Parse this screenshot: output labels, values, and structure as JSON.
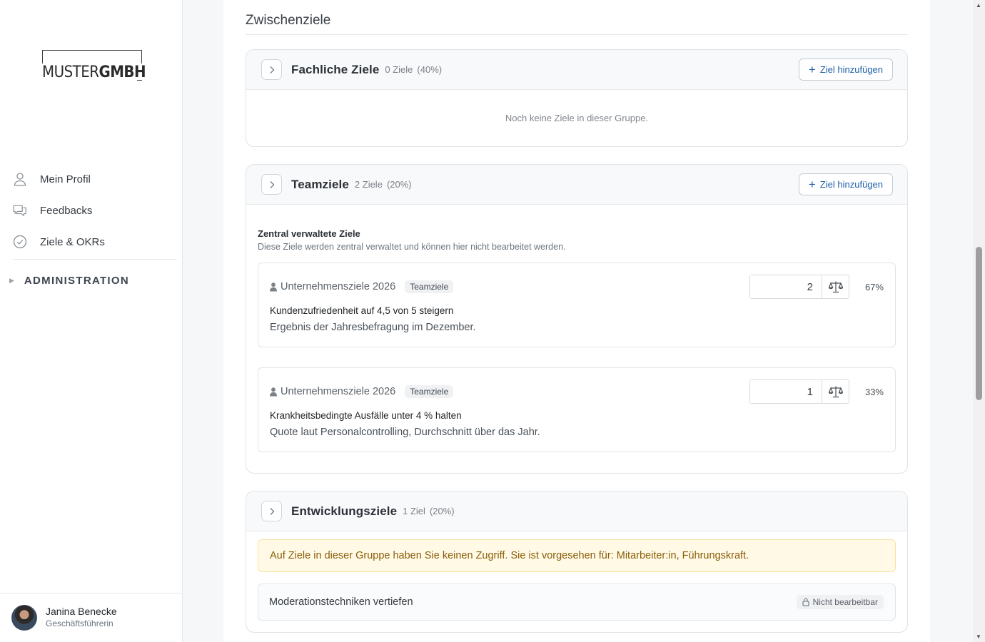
{
  "brand": {
    "logo_light": "MUSTER",
    "logo_bold": "GMBH"
  },
  "sidebar": {
    "items": [
      {
        "label": "Mein Profil",
        "icon": "user-icon"
      },
      {
        "label": "Feedbacks",
        "icon": "chat-icon"
      },
      {
        "label": "Ziele & OKRs",
        "icon": "check-circle-icon"
      }
    ],
    "admin_label": "ADMINISTRATION"
  },
  "user": {
    "name": "Janina Benecke",
    "role": "Geschäftsführerin"
  },
  "section": {
    "title": "Zwischenziele"
  },
  "groups": {
    "fachlich": {
      "title": "Fachliche Ziele",
      "count": "0 Ziele",
      "percent": "(40%)",
      "add_label": "Ziel hinzufügen",
      "empty_text": "Noch keine Ziele in dieser Gruppe."
    },
    "team": {
      "title": "Teamziele",
      "count": "2 Ziele",
      "percent": "(20%)",
      "add_label": "Ziel hinzufügen",
      "central_title": "Zentral verwaltete Ziele",
      "central_subtitle": "Diese Ziele werden zentral verwaltet und können hier nicht bearbeitet werden.",
      "goals": [
        {
          "source": "Unternehmensziele 2026",
          "badge": "Teamziele",
          "title": "Kundenzufriedenheit auf 4,5 von 5 steigern",
          "description": "Ergebnis der Jahresbefragung im Dezember.",
          "weight": "2",
          "percent": "67%"
        },
        {
          "source": "Unternehmensziele 2026",
          "badge": "Teamziele",
          "title": "Krankheitsbedingte Ausfälle unter 4 % halten",
          "description": "Quote laut Personalcontrolling, Durchschnitt über das Jahr.",
          "weight": "1",
          "percent": "33%"
        }
      ]
    },
    "entwicklung": {
      "title": "Entwicklungsziele",
      "count": "1 Ziel",
      "percent": "(20%)",
      "alert": "Auf Ziele in dieser Gruppe haben Sie keinen Zugriff. Sie ist vorgesehen für: Mitarbeiter:in, Führungskraft.",
      "locked_goal": "Moderationstechniken vertiefen",
      "locked_badge": "Nicht bearbeitbar"
    }
  },
  "colors": {
    "accent": "#1f5fa8",
    "alert_bg": "#fff9e6",
    "alert_text": "#8a5d07"
  }
}
